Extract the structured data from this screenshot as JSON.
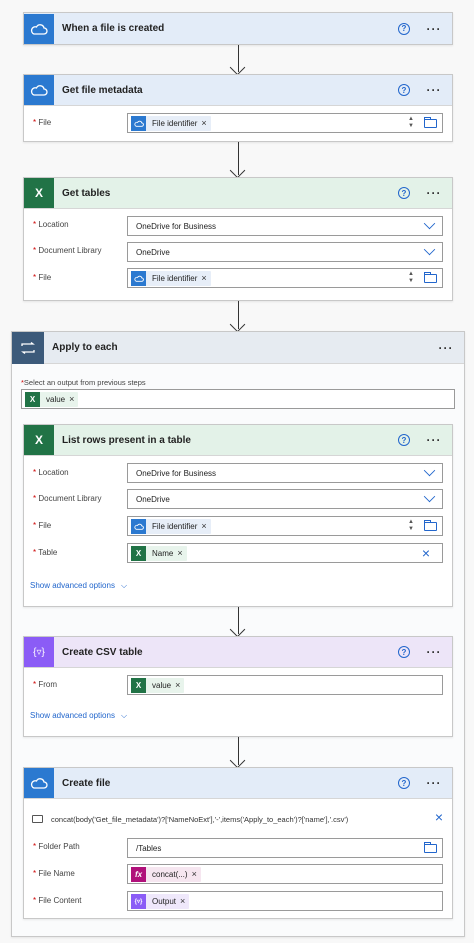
{
  "steps": {
    "trigger": {
      "title": "When a file is created"
    },
    "metadata": {
      "title": "Get file metadata",
      "file_label": "File",
      "file_token": "File identifier"
    },
    "tables": {
      "title": "Get tables",
      "location_label": "Location",
      "location_value": "OneDrive for Business",
      "library_label": "Document Library",
      "library_value": "OneDrive",
      "file_label": "File",
      "file_token": "File identifier"
    },
    "apply": {
      "title": "Apply to each",
      "select_label": "Select an output from previous steps",
      "select_token": "value"
    },
    "listrows": {
      "title": "List rows present in a table",
      "location_label": "Location",
      "location_value": "OneDrive for Business",
      "library_label": "Document Library",
      "library_value": "OneDrive",
      "file_label": "File",
      "file_token": "File identifier",
      "table_label": "Table",
      "table_token": "Name",
      "advanced": "Show advanced options"
    },
    "csv": {
      "title": "Create CSV table",
      "from_label": "From",
      "from_token": "value",
      "advanced": "Show advanced options"
    },
    "createfile": {
      "title": "Create file",
      "expression": "concat(body('Get_file_metadata')?['NameNoExt'],'-',items('Apply_to_each')?['name'],'.csv')",
      "folder_label": "Folder Path",
      "folder_value": "/Tables",
      "name_label": "File Name",
      "name_token": "concat(...)",
      "content_label": "File Content",
      "content_token": "Output"
    }
  },
  "common": {
    "required_mark": "*",
    "help_glyph": "?",
    "more_glyph": "···",
    "remove_glyph": "×"
  },
  "icons": {
    "onedrive": "onedrive-icon",
    "excel": "excel-icon",
    "csv": "data-operation-icon",
    "loop": "loop-icon",
    "expression": "fx-icon",
    "comment": "comment-icon"
  },
  "colors": {
    "accent": "#2266cc",
    "onedrive": "#2b79d0",
    "excel": "#217346",
    "dataop": "#8b5cf6",
    "loop": "#3c5a7a"
  }
}
